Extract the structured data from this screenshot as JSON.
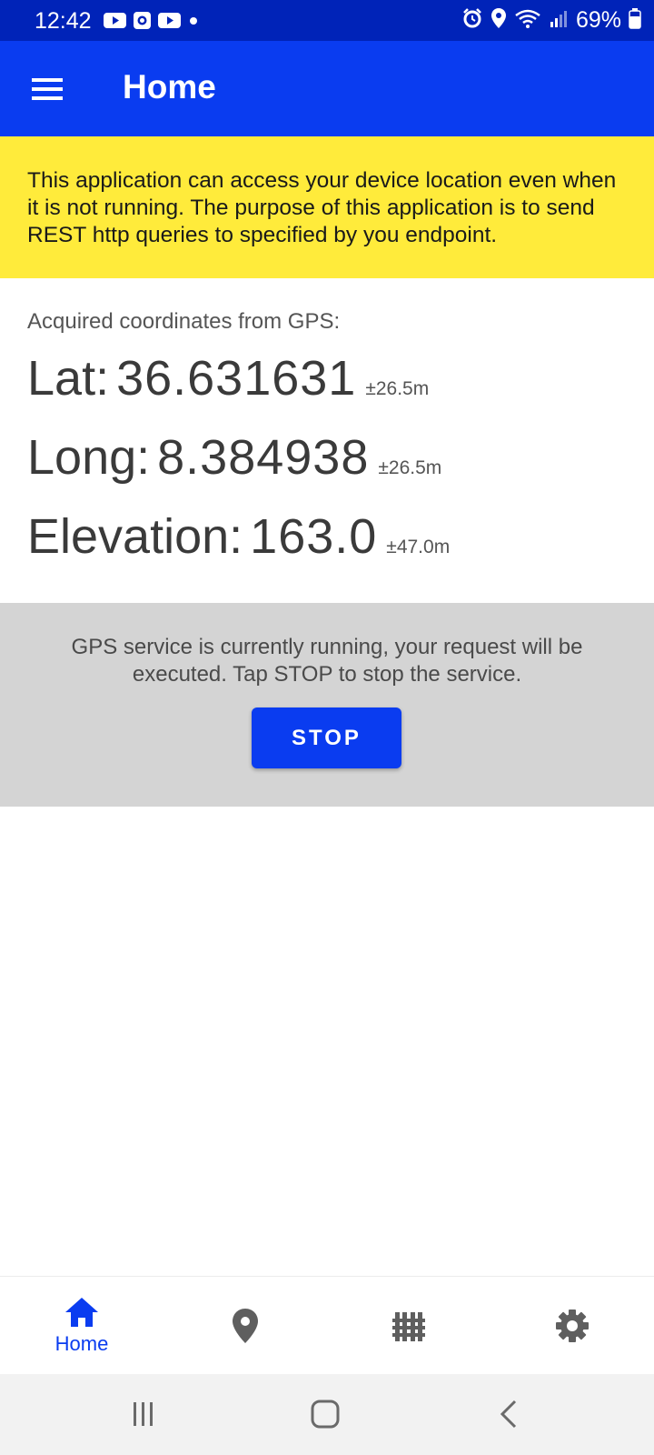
{
  "status_bar": {
    "time": "12:42",
    "battery": "69%",
    "left_icons": [
      "youtube-icon",
      "screen-record-icon",
      "youtube-icon",
      "dot-icon"
    ],
    "right_icons": [
      "alarm-icon",
      "location-icon",
      "wifi-icon",
      "signal-icon",
      "battery-icon"
    ]
  },
  "app_bar": {
    "title": "Home",
    "menu_icon": "hamburger-menu-icon"
  },
  "warning": {
    "text": "This application can access your device location even when it is not running. The purpose of this application is to send REST http queries to specified by you endpoint."
  },
  "coordinates": {
    "heading": "Acquired coordinates from GPS:",
    "lat": {
      "label": "Lat:",
      "value": "36.631631",
      "accuracy": "±26.5m"
    },
    "long": {
      "label": "Long:",
      "value": "8.384938",
      "accuracy": "±26.5m"
    },
    "elevation": {
      "label": "Elevation:",
      "value": "163.0",
      "accuracy": "±47.0m"
    }
  },
  "service": {
    "message": "GPS service is currently running, your request will be executed. Tap STOP to stop the service.",
    "stop_label": "STOP"
  },
  "bottom_nav": {
    "items": [
      {
        "icon": "home-icon",
        "label": "Home",
        "active": true
      },
      {
        "icon": "location-pin-icon",
        "label": ""
      },
      {
        "icon": "grid-fence-icon",
        "label": ""
      },
      {
        "icon": "settings-gear-icon",
        "label": ""
      }
    ]
  },
  "system_nav": [
    "recent-apps-icon",
    "home-button-icon",
    "back-icon"
  ],
  "colors": {
    "status_bar": "#0023b8",
    "primary": "#0a3cf0",
    "warning_bg": "#ffeb3b",
    "panel_bg": "#d4d4d4",
    "icon_gray": "#5f5f5f"
  }
}
